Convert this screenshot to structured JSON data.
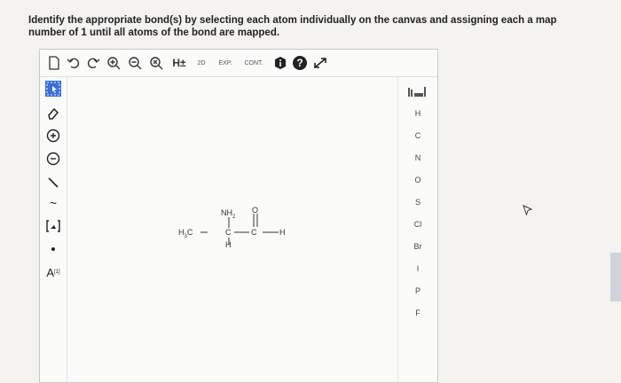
{
  "instructions": "Identify the appropriate bond(s) by selecting each atom individually on the canvas and assigning each a map number of 1 until all atoms of the bond are mapped.",
  "toolbar": {
    "hydrogen_label": "H±",
    "r2d_label": "2D",
    "exp_label": "EXP.",
    "cont_label": "CONT.",
    "help_label": "?"
  },
  "left_tools": {
    "chain_label": "~",
    "atom_map_label": "A",
    "atom_map_superscript": "[1]"
  },
  "periodic": {
    "elements": [
      "H",
      "C",
      "N",
      "O",
      "S",
      "Cl",
      "Br",
      "I",
      "P",
      "F"
    ]
  },
  "molecule": {
    "nh2": "NH",
    "nh2_sub": "2",
    "o": "O",
    "h3c": "H",
    "h3c_sub": "3",
    "h3c_c": "C",
    "c_center": "C",
    "c_right": "C",
    "h_right": "H",
    "h_below": "H"
  }
}
